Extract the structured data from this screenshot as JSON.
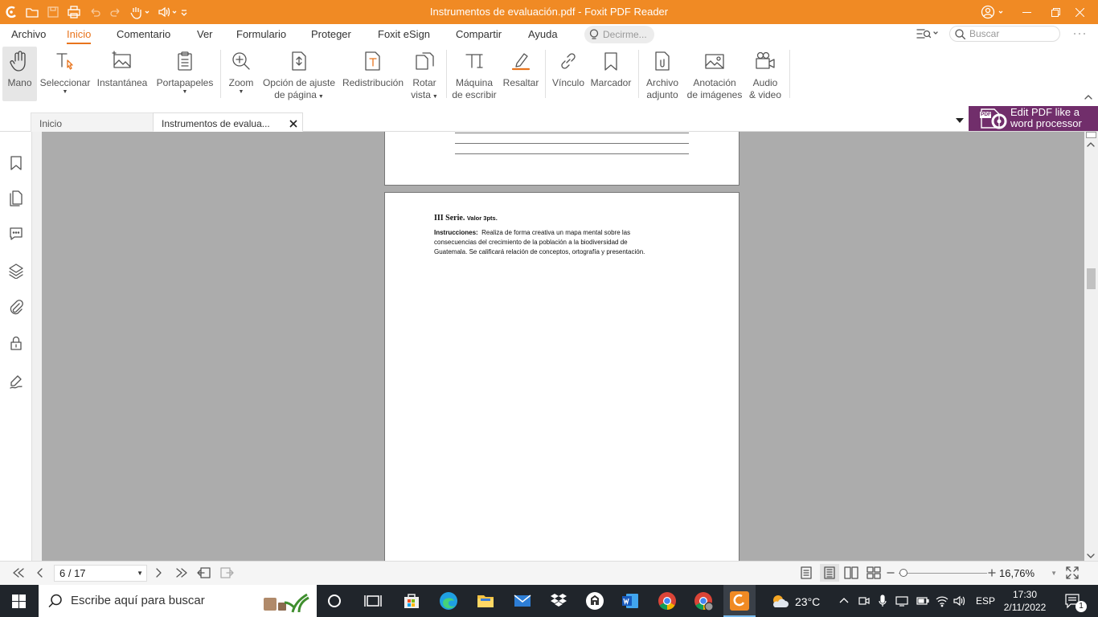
{
  "window": {
    "title": "Instrumentos de evaluación.pdf - Foxit PDF Reader"
  },
  "menu": [
    "Archivo",
    "Inicio",
    "Comentario",
    "Ver",
    "Formulario",
    "Proteger",
    "Foxit eSign",
    "Compartir",
    "Ayuda"
  ],
  "tell_me": {
    "placeholder": "Decirme..."
  },
  "search": {
    "placeholder": "Buscar"
  },
  "ribbon": {
    "mano": "Mano",
    "seleccionar": "Seleccionar",
    "instantanea": "Instantánea",
    "portapapeles": "Portapapeles",
    "zoom": "Zoom",
    "ajuste_1": "Opción de ajuste",
    "ajuste_2": "de página",
    "redistribucion": "Redistribución",
    "rotar_1": "Rotar",
    "rotar_2": "vista",
    "maquina_1": "Máquina",
    "maquina_2": "de escribir",
    "resaltar": "Resaltar",
    "vinculo": "Vínculo",
    "marcador": "Marcador",
    "archivo_1": "Archivo",
    "archivo_2": "adjunto",
    "anotacion_1": "Anotación",
    "anotacion_2": "de imágenes",
    "audio_1": "Audio",
    "audio_2": "& video"
  },
  "tabs": {
    "home": "Inicio",
    "doc": "Instrumentos de evalua..."
  },
  "promo": {
    "line1": "Edit PDF like a",
    "line2": "word processor",
    "badge": "PDF"
  },
  "document": {
    "serie": "III Serie.",
    "valor": "Valor 3pts.",
    "instr_label": "Instrucciones:",
    "instr_line1": "Realiza de forma creativa un mapa mental sobre las",
    "instr_line2": "consecuencias del crecimiento de la población a la biodiversidad de",
    "instr_line3": "Guatemala. Se calificará relación de conceptos, ortografía y presentación."
  },
  "status": {
    "page": "6 / 17",
    "zoom": "16,76%"
  },
  "taskbar": {
    "search_placeholder": "Escribe aquí para buscar",
    "weather": "23°C",
    "lang": "ESP",
    "time": "17:30",
    "date": "2/11/2022",
    "notifications": "1"
  },
  "colors": {
    "accent": "#f08a24",
    "promo": "#712e6b",
    "taskbar": "#20252b"
  }
}
